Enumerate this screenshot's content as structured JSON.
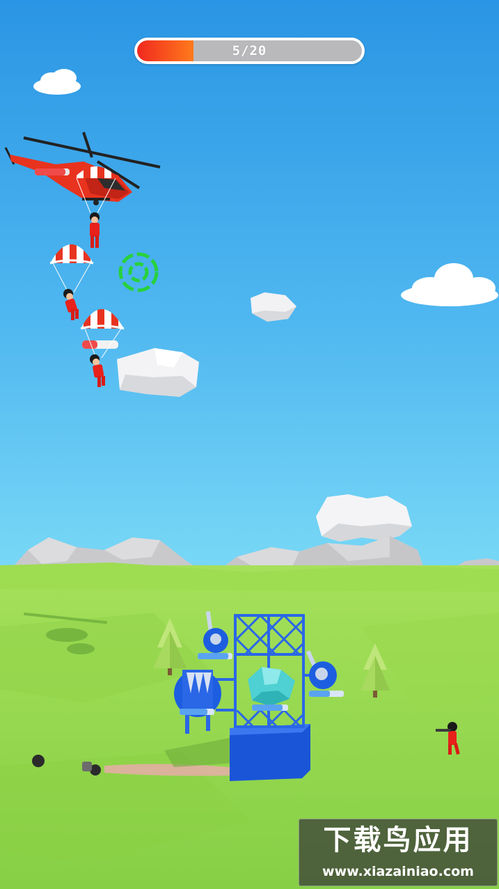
{
  "hud": {
    "progress_label": "5/20",
    "progress_fraction": 0.25,
    "fill_color": "#f0281e"
  },
  "watermark": {
    "title": "下载鸟应用",
    "url": "www.xiazainiao.com"
  },
  "colors": {
    "sky_top": "#2f9be6",
    "sky_horizon": "#72d4f5",
    "grass": "#8fd648",
    "tower_blue": "#1f5fe0",
    "enemy_red": "#e8211b"
  }
}
